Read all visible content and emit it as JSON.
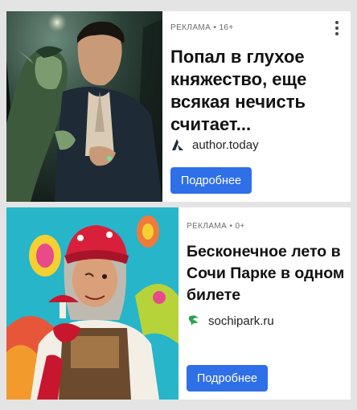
{
  "ads": [
    {
      "label": "РЕКЛАМА • 16+",
      "headline": "Попал в глухое княжество, еще всякая нечисть считает...",
      "domain": "author.today",
      "domain_icon": "author-today-logo-icon",
      "cta": "Подробнее",
      "image": "fantasy-book-cover-image"
    },
    {
      "label": "РЕКЛАМА • 0+",
      "headline": "Бесконечное лето в Сочи Парке в одном билете",
      "domain": "sochipark.ru",
      "domain_icon": "sochipark-logo-icon",
      "cta": "Подробнее",
      "image": "baba-yaga-character-image"
    }
  ],
  "colors": {
    "button": "#2f6fe8",
    "background": "#e4e4e4",
    "sochipark_green": "#2aa54a"
  }
}
